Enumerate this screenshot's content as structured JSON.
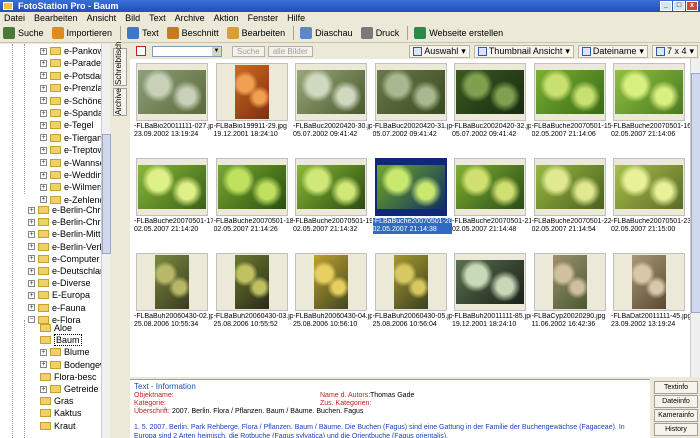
{
  "window": {
    "title": "FotoStation Pro - Baum",
    "controls": [
      "_",
      "□",
      "x"
    ]
  },
  "menu": [
    "Datei",
    "Bearbeiten",
    "Ansicht",
    "Bild",
    "Text",
    "Archive",
    "Aktion",
    "Fenster",
    "Hilfe"
  ],
  "toolbar": [
    {
      "label": "Suche",
      "icon": "search-icon",
      "color": "#4a7a3a"
    },
    {
      "label": "Importieren",
      "icon": "import-icon",
      "color": "#e08a20"
    },
    {
      "label": "Text",
      "icon": "pen-icon",
      "color": "#3a78c8"
    },
    {
      "label": "Beschnitt",
      "icon": "crop-icon",
      "color": "#c87a20"
    },
    {
      "label": "Bearbeiten",
      "icon": "edit-icon",
      "color": "#d8a030"
    },
    {
      "label": "Diaschau",
      "icon": "slideshow-icon",
      "color": "#5a88c8"
    },
    {
      "label": "Druck",
      "icon": "print-icon",
      "color": "#7a7a7a"
    },
    {
      "label": "Webseite erstellen",
      "icon": "globe-icon",
      "color": "#2a8a4a"
    }
  ],
  "tree": {
    "level2": [
      "e-Pankow",
      "e-Paraden",
      "e-Potsdam",
      "e-Prenzlau",
      "e-Schöneb",
      "e-Spandau",
      "e-Tegel",
      "e-Tiergart",
      "e-Treptow",
      "e-Wannse",
      "e-Wedding",
      "e-Wilmers",
      "e-Zehlend"
    ],
    "level1": [
      "e-Berlin-Chris",
      "e-Berlin-Chris",
      "e-Berlin-Mitte",
      "e-Berlin-Verk",
      "e-Computer",
      "e-Deutschlar",
      "e-Diverse",
      "E-Europa",
      "e-Fauna",
      "e-Flora"
    ],
    "flora": [
      "Aloe",
      "Baum",
      "Blume",
      "Bodengew",
      "Flora-besc",
      "Getreide",
      "Gras",
      "Kaktus",
      "Kraut"
    ],
    "selected": "Baum"
  },
  "sidetabs": [
    "Schreibtisch",
    "Archive"
  ],
  "filter": {
    "search_label": "Suche",
    "all_label": "alle Bilder"
  },
  "view_controls": [
    {
      "label": "Auswahl",
      "icon": "checkbox-icon"
    },
    {
      "label": "Thumbnail Ansicht",
      "icon": "thumbnail-icon"
    },
    {
      "label": "Dateiname",
      "icon": "sort-icon"
    },
    {
      "label": "7 x 4",
      "icon": "grid-icon"
    }
  ],
  "thumbnails": [
    {
      "file": "-FLBaBio20011111-027.jpg",
      "date": "23.09.2002 13:19:24",
      "palette": [
        "#8ea07a",
        "#5a6a3a",
        "#c8d0b8"
      ],
      "orient": "land"
    },
    {
      "file": "-FLBaBio199911-29.jpg",
      "date": "19.12.2001 18:24:10",
      "palette": [
        "#d06a20",
        "#7a3010",
        "#f0a050"
      ],
      "orient": "port"
    },
    {
      "file": "-FLBaBuc20020420-30.jpg",
      "date": "05.07.2002 09:41:42",
      "palette": [
        "#98a878",
        "#4a5a30",
        "#d0d8c0"
      ],
      "orient": "land"
    },
    {
      "file": "-FLBaBuc20020420-31.jpg",
      "date": "05.07.2002 09:41:42",
      "palette": [
        "#6a7a4a",
        "#3a4a20",
        "#a8b890"
      ],
      "orient": "land"
    },
    {
      "file": "-FLBaBuc20020420-32.jpg",
      "date": "05.07.2002 09:41:42",
      "palette": [
        "#3a5a20",
        "#1a2a10",
        "#80a050"
      ],
      "orient": "land"
    },
    {
      "file": "-FLBaBuche20070501-15.jpg",
      "date": "02.05.2007 21:14:06",
      "palette": [
        "#7ab030",
        "#3a6a18",
        "#c8e070"
      ],
      "orient": "land"
    },
    {
      "file": "-FLBaBuche20070501-16.jpg",
      "date": "02.05.2007 21:14:06",
      "palette": [
        "#90c040",
        "#4a7a20",
        "#d8f080"
      ],
      "orient": "land"
    },
    {
      "file": "-FLBaBuche20070501-17.jpg",
      "date": "02.05.2007 21:14:20",
      "palette": [
        "#88b838",
        "#3a6018",
        "#e0f088"
      ],
      "orient": "land"
    },
    {
      "file": "-FLBaBuche20070501-18.jpg",
      "date": "02.05.2007 21:14:26",
      "palette": [
        "#78a830",
        "#2a5010",
        "#c0e060"
      ],
      "orient": "land"
    },
    {
      "file": "-FLBaBuche20070501-19.jpg",
      "date": "02.05.2007 21:14:32",
      "palette": [
        "#8ab838",
        "#2a4a10",
        "#d0e878"
      ],
      "orient": "land"
    },
    {
      "file": "-FLBaBuche20070501-20.jpg",
      "date": "02.05.2007 21:14:38",
      "palette": [
        "#70a828",
        "#103060",
        "#c8e870"
      ],
      "orient": "land"
    },
    {
      "file": "-FLBaBuche20070501-21.jpg",
      "date": "02.05.2007 21:14:48",
      "palette": [
        "#80b030",
        "#2a4a18",
        "#d0e070"
      ],
      "orient": "land"
    },
    {
      "file": "-FLBaBuche20070501-22.jpg",
      "date": "02.05.2007 21:14:54",
      "palette": [
        "#98b840",
        "#4a6020",
        "#e0e890"
      ],
      "orient": "land"
    },
    {
      "file": "-FLBaBuche20070501-23.jpg",
      "date": "02.05.2007 21:15:00",
      "palette": [
        "#a8c048",
        "#5a6a28",
        "#e8f098"
      ],
      "orient": "land"
    },
    {
      "file": "-FLBaBuh20060430-02.jpg",
      "date": "25.08.2006 10:55:34",
      "palette": [
        "#7a8a40",
        "#3a3a20",
        "#b8b868"
      ],
      "orient": "port"
    },
    {
      "file": "-FLBaBuh20060430-03.jpg",
      "date": "25.08.2006 10:55:52",
      "palette": [
        "#6a7a30",
        "#2a2a18",
        "#c0c060"
      ],
      "orient": "port"
    },
    {
      "file": "-FLBaBuh20060430-04.jpg",
      "date": "25.08.2006 10:56:10",
      "palette": [
        "#c0a030",
        "#404820",
        "#e8d060"
      ],
      "orient": "port"
    },
    {
      "file": "-FLBaBuh20060430-05.jpg",
      "date": "25.08.2006 10:56:04",
      "palette": [
        "#a89830",
        "#3a4020",
        "#d8c860"
      ],
      "orient": "port"
    },
    {
      "file": "-FLBaBuh20011111-85.jpg",
      "date": "19.12.2001 18:24:10",
      "palette": [
        "#5a7050",
        "#1a2018",
        "#c8d8b8"
      ],
      "orient": "land"
    },
    {
      "file": "-FLBaCyp20020290.jpg",
      "date": "11.06.2002 16:42:36",
      "palette": [
        "#a09070",
        "#485a30",
        "#d0c0a0"
      ],
      "orient": "port"
    },
    {
      "file": "-FLBaDat20011111-45.jpg",
      "date": "23.09.2002 13:19:24",
      "palette": [
        "#a89878",
        "#5a4a30",
        "#d8c8a8"
      ],
      "orient": "port"
    }
  ],
  "info": {
    "title": "Text - Information",
    "objektname_label": "Objektname:",
    "kategorie_label": "Kategorie:",
    "ueberschrift_label": "Überschrift:",
    "ueberschrift_value": "2007. Berlin. Flora / Pflanzen. Baum / Bäume. Buchen. Fagus",
    "autor_label": "Name d. Autors:",
    "autor_value": "Thomas Gade",
    "zus_label": "Zus. Kategorien:",
    "body": "1. 5. 2007. Berlin. Park Rehberge. Flora / Pflanzen. Baum / Bäume. Die Buchen (Fagus) sind eine Gattung in der Familie der Buchengewächse (Fagaceae). In Europa sind 2 Arten heimisch, die Rotbuche (Fagus sylvatica) und die Orientbuche (Fagus orientalis)."
  },
  "info_tabs": [
    "Textinfo",
    "Dateiinfo",
    "Kamerainfo",
    "History"
  ]
}
